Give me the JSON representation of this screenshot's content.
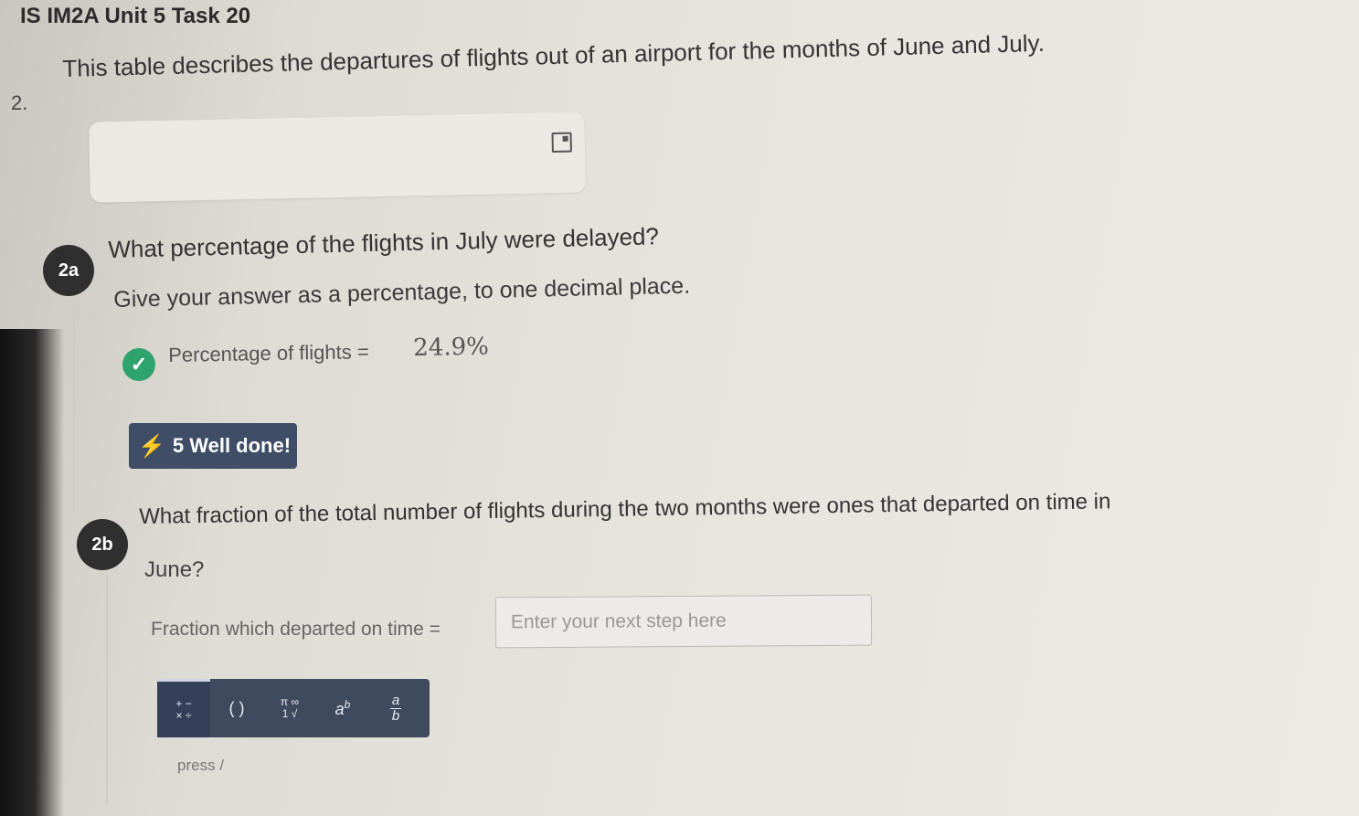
{
  "task_title": "IS IM2A Unit 5 Task 20",
  "question": {
    "number": "2.",
    "text": "This table describes the departures of flights out of an airport for the months of June and July."
  },
  "part_2a": {
    "badge": "2a",
    "question": "What percentage of the flights in July were delayed?",
    "instruction": "Give your answer as a percentage, to one decimal place.",
    "answer_label": "Percentage of flights =",
    "answer_value": "24.9%",
    "feedback": "5 Well done!"
  },
  "part_2b": {
    "badge": "2b",
    "question_line1": "What fraction of the total number of flights during the two months were ones that departed on time in",
    "question_line2": "June?",
    "input_label": "Fraction which departed on time =",
    "input_placeholder": "Enter your next step here",
    "toolbar": {
      "operators": {
        "top": "+ −",
        "bottom": "× ÷"
      },
      "parentheses": "( )",
      "symbols": {
        "top": "π ∞",
        "bottom": "1 √"
      },
      "power": {
        "base": "a",
        "exp": "b"
      },
      "fraction": {
        "num": "a",
        "den": "b"
      }
    },
    "hint": "press  /"
  },
  "colors": {
    "badge": "#2f2f2f",
    "check": "#2ea36d",
    "feedback_bg": "#3f4d66",
    "toolbar_bg": "#3e4a5e",
    "bolt": "#f39a2b"
  }
}
